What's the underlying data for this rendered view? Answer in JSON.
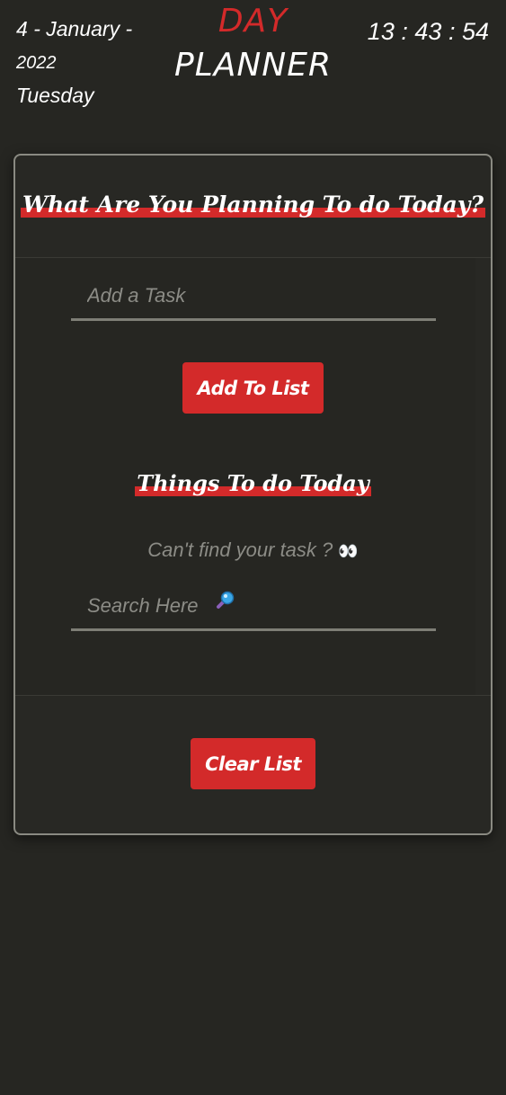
{
  "header": {
    "day": "4",
    "month": "January",
    "year": "2022",
    "weekday": "Tuesday",
    "title_top": "DAY",
    "title_bottom": "PLANNER",
    "time_h": "13",
    "time_m": "43",
    "time_s": "54"
  },
  "card": {
    "heading": "What Are You Planning To do Today?",
    "task_placeholder": "Add a Task",
    "add_button": "Add To List",
    "list_heading": "Things To do Today",
    "hint": "Can't find your task ?",
    "hint_emoji": "👀",
    "search_placeholder": "Search Here",
    "search_icon": "magnifier-icon",
    "clear_button": "Clear List"
  },
  "colors": {
    "background": "#262622",
    "accent": "#d32a2a",
    "border": "#8a8a82"
  }
}
